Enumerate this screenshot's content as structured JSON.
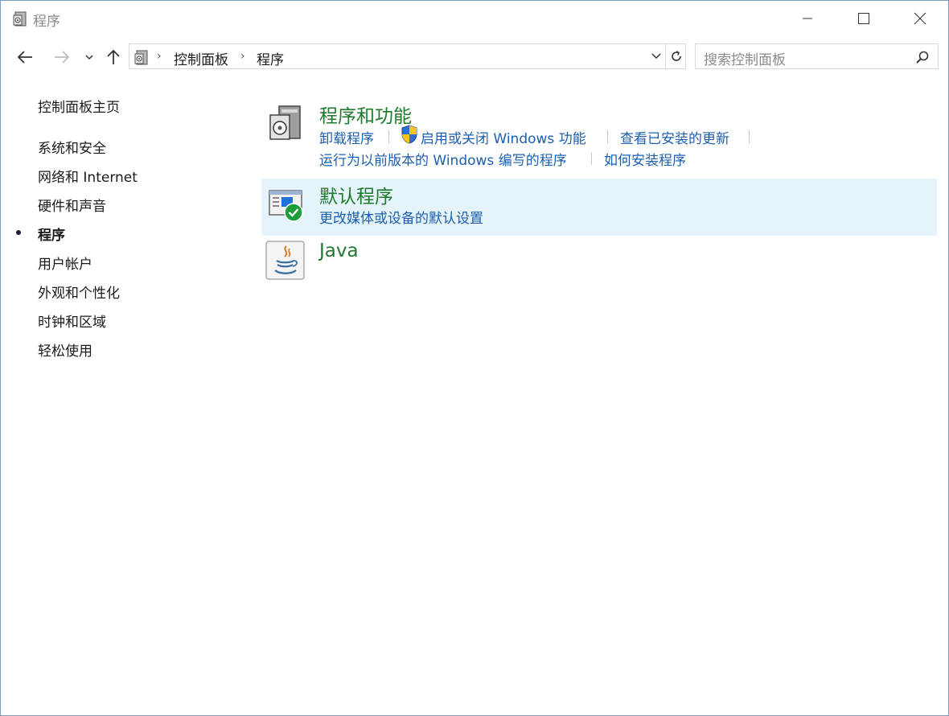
{
  "window": {
    "title": "程序"
  },
  "nav": {
    "breadcrumb": [
      "控制面板",
      "程序"
    ],
    "search_placeholder": "搜索控制面板"
  },
  "sidebar": {
    "items": [
      {
        "label": "控制面板主页"
      },
      {
        "label": "系统和安全"
      },
      {
        "label": "网络和 Internet"
      },
      {
        "label": "硬件和声音"
      },
      {
        "label": "程序",
        "active": true
      },
      {
        "label": "用户帐户"
      },
      {
        "label": "外观和个性化"
      },
      {
        "label": "时钟和区域"
      },
      {
        "label": "轻松使用"
      }
    ]
  },
  "categories": [
    {
      "title": "程序和功能",
      "icon": "programs-features-icon",
      "links": [
        "卸载程序",
        "启用或关闭 Windows 功能",
        "查看已安装的更新",
        "运行为以前版本的 Windows 编写的程序",
        "如何安装程序"
      ]
    },
    {
      "title": "默认程序",
      "icon": "default-programs-icon",
      "links": [
        "更改媒体或设备的默认设置"
      ]
    },
    {
      "title": "Java",
      "icon": "java-icon",
      "links": []
    }
  ],
  "colors": {
    "title_green": "#1e7a2d",
    "link_blue": "#1c5fb0",
    "highlight": "#e5f3fb"
  }
}
